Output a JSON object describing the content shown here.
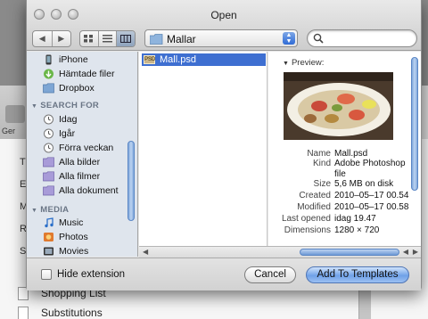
{
  "dialog": {
    "title": "Open",
    "path": "Mallar",
    "search_placeholder": "",
    "hide_extension_label": "Hide extension",
    "cancel_label": "Cancel",
    "primary_label": "Add To Templates"
  },
  "sidebar": {
    "devices_partial": [
      {
        "label": "iPhone",
        "icon": "iphone-icon"
      },
      {
        "label": "Hämtade filer",
        "icon": "downloads-icon"
      },
      {
        "label": "Dropbox",
        "icon": "dropbox-folder-icon"
      }
    ],
    "search_for_header": "SEARCH FOR",
    "search_for": [
      {
        "label": "Idag",
        "icon": "clock-icon"
      },
      {
        "label": "Igår",
        "icon": "clock-icon"
      },
      {
        "label": "Förra veckan",
        "icon": "clock-icon"
      },
      {
        "label": "Alla bilder",
        "icon": "smart-folder-icon"
      },
      {
        "label": "Alla filmer",
        "icon": "smart-folder-icon"
      },
      {
        "label": "Alla dokument",
        "icon": "smart-folder-icon"
      }
    ],
    "media_header": "MEDIA",
    "media": [
      {
        "label": "Music",
        "icon": "music-icon"
      },
      {
        "label": "Photos",
        "icon": "photos-icon"
      },
      {
        "label": "Movies",
        "icon": "movies-icon"
      }
    ]
  },
  "file_list": {
    "selected_file": "Mall.psd",
    "file_icon_text": "PSD"
  },
  "preview": {
    "header": "Preview:",
    "metadata": [
      {
        "key": "Name",
        "value": "Mall.psd"
      },
      {
        "key": "Kind",
        "value": "Adobe Photoshop file"
      },
      {
        "key": "Size",
        "value": "5,6 MB on disk"
      },
      {
        "key": "Created",
        "value": "2010–05–17 00.54"
      },
      {
        "key": "Modified",
        "value": "2010–05–17 00.58"
      },
      {
        "key": "Last opened",
        "value": "idag 19.47"
      },
      {
        "key": "Dimensions",
        "value": "1280 × 720"
      }
    ]
  },
  "background_app": {
    "toolbar_label": "Ger",
    "row_letters": [
      "T",
      "E",
      "M",
      "R",
      "S"
    ],
    "rows": [
      "Shopping List",
      "Substitutions"
    ]
  },
  "colors": {
    "selection": "#3e6fd1",
    "sidebar_bg": "#dfe5ed",
    "primary_button": "#6fa1e8"
  }
}
